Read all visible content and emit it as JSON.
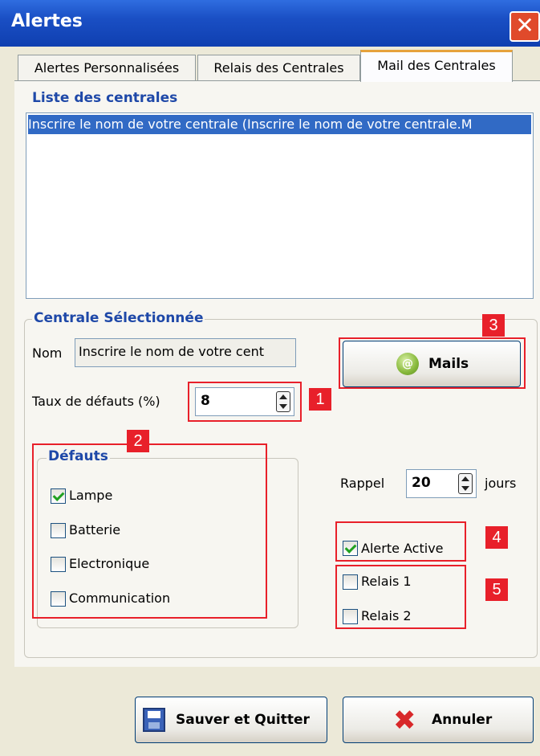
{
  "window": {
    "title": "Alertes",
    "close_glyph": "✕"
  },
  "tabs": [
    {
      "label": "Alertes Personnalisées"
    },
    {
      "label": "Relais des Centrales"
    },
    {
      "label": "Mail des Centrales"
    }
  ],
  "list_group": {
    "legend": "Liste des centrales",
    "items": [
      "Inscrire le nom de votre centrale (Inscrire le nom de votre centrale.M"
    ]
  },
  "selected_group": {
    "legend": "Centrale Sélectionnée",
    "nom_label": "Nom",
    "nom_value": "Inscrire le nom de votre cent",
    "taux_label": "Taux de défauts (%)",
    "taux_value": "8",
    "mails_button": "Mails",
    "mails_icon": "mail-at-icon"
  },
  "defauts_group": {
    "legend": "Défauts",
    "items": [
      {
        "label": "Lampe",
        "checked": true
      },
      {
        "label": "Batterie",
        "checked": false
      },
      {
        "label": "Electronique",
        "checked": false
      },
      {
        "label": "Communication",
        "checked": false
      }
    ]
  },
  "rappel": {
    "label": "Rappel",
    "value": "20",
    "unit": "jours"
  },
  "alerte_active": {
    "label": "Alerte Active",
    "checked": true
  },
  "relais": [
    {
      "label": "Relais 1",
      "checked": false
    },
    {
      "label": "Relais 2",
      "checked": false
    }
  ],
  "annotations": [
    "1",
    "2",
    "3",
    "4",
    "5"
  ],
  "buttons": {
    "save": "Sauver et Quitter",
    "cancel": "Annuler"
  },
  "colors": {
    "title_bar": "#1a4fc4",
    "highlight": "#e8202a",
    "legend": "#1e48a8",
    "selection": "#316ac5"
  }
}
